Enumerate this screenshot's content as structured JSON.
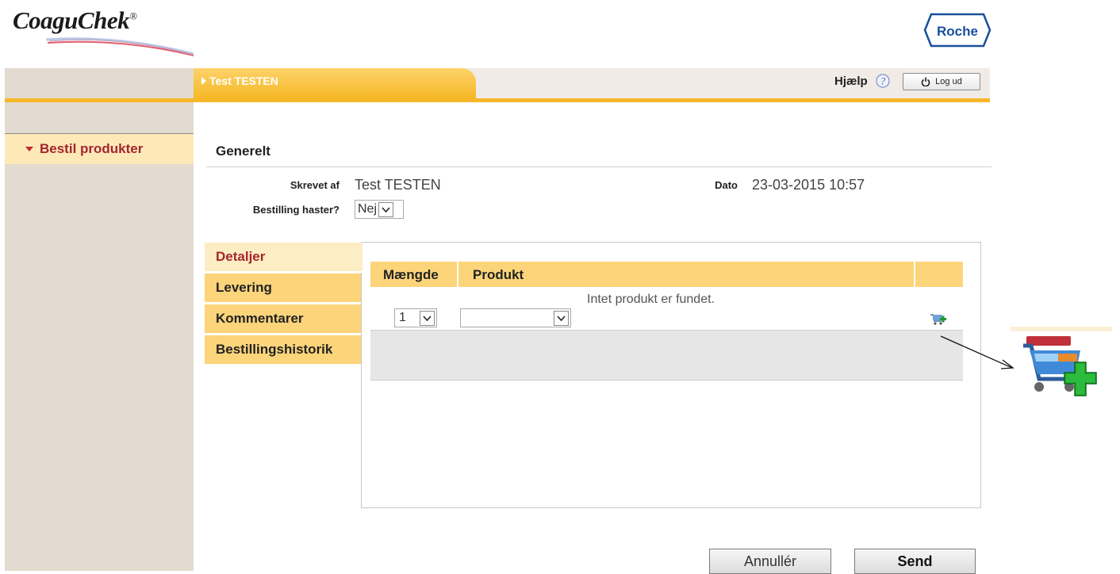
{
  "brand": {
    "product_logo": "CoaguChek",
    "registered": "®",
    "company_logo": "Roche"
  },
  "topbar": {
    "user_tab": "Test TESTEN",
    "help_label": "Hjælp",
    "logout_label": "Log ud"
  },
  "sidebar": {
    "items": [
      {
        "label": "Bestil produkter"
      }
    ]
  },
  "general": {
    "title": "Generelt",
    "written_by_label": "Skrevet af",
    "written_by_value": "Test TESTEN",
    "date_label": "Dato",
    "date_value": "23-03-2015 10:57",
    "urgent_label": "Bestilling haster?",
    "urgent_value": "Nej"
  },
  "tabs": [
    {
      "label": "Detaljer",
      "active": true
    },
    {
      "label": "Levering"
    },
    {
      "label": "Kommentarer"
    },
    {
      "label": "Bestillingshistorik"
    }
  ],
  "table": {
    "columns": [
      "Mængde",
      "Produkt"
    ],
    "empty_message": "Intet produkt er fundet.",
    "quantity_value": "1",
    "product_value": ""
  },
  "actions": {
    "cancel_label": "Annullér",
    "send_label": "Send"
  },
  "icons": {
    "add_to_cart": "cart-add-icon",
    "help": "help-icon",
    "power": "power-icon"
  },
  "colors": {
    "accent": "#f5b72a",
    "tab": "#fcd47a",
    "sidebar": "#e3dad0",
    "active_text": "#a3262e"
  }
}
